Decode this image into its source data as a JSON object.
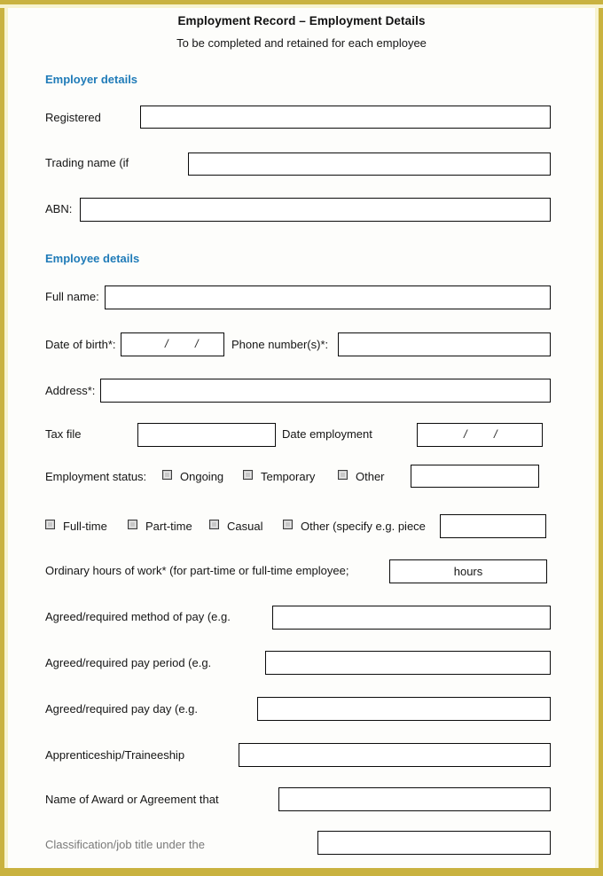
{
  "document": {
    "title": "Employment Record – Employment Details",
    "subtitle": "To be completed and retained for each employee"
  },
  "colors": {
    "border_gold": "#c9b23f",
    "heading_blue": "#1f7bb8",
    "checkbox_fill": "#c8c8c8",
    "page_background": "#fdfdfb"
  },
  "sections": {
    "employer": {
      "heading": "Employer details",
      "fields": [
        {
          "label": "Registered",
          "value": ""
        },
        {
          "label": "Trading name (if",
          "value": ""
        },
        {
          "label": "ABN:",
          "value": ""
        }
      ]
    },
    "employee": {
      "heading": "Employee details",
      "fields": [
        {
          "label": "Full name:",
          "value": ""
        },
        {
          "label": "Date of birth*:",
          "value": "",
          "separator": "/"
        },
        {
          "label": "Phone number(s)*:",
          "value": ""
        },
        {
          "label": "Address*:",
          "value": ""
        },
        {
          "label": "Tax file",
          "value": ""
        },
        {
          "label": "Date employment",
          "value": "",
          "separator": "/"
        },
        {
          "label": "Employment status:",
          "value": ""
        },
        {
          "label": "Ordinary hours of work* (for part-time or full-time employee;",
          "value": "hours"
        },
        {
          "label": "Agreed/required method of pay (e.g.",
          "value": ""
        },
        {
          "label": "Agreed/required pay period (e.g.",
          "value": ""
        },
        {
          "label": "Agreed/required pay day (e.g.",
          "value": ""
        },
        {
          "label": "Apprenticeship/Traineeship",
          "value": ""
        },
        {
          "label": "Name of Award or Agreement that",
          "value": ""
        },
        {
          "label": "Classification/job title under the",
          "value": ""
        }
      ],
      "status_checkboxes": [
        {
          "label": "Ongoing",
          "checked": false
        },
        {
          "label": "Temporary",
          "checked": false
        },
        {
          "label": "Other",
          "checked": false
        }
      ],
      "type_checkboxes": [
        {
          "label": "Full-time",
          "checked": false
        },
        {
          "label": "Part-time",
          "checked": false
        },
        {
          "label": "Casual",
          "checked": false
        },
        {
          "label": "Other (specify e.g. piece",
          "checked": false
        }
      ]
    }
  }
}
